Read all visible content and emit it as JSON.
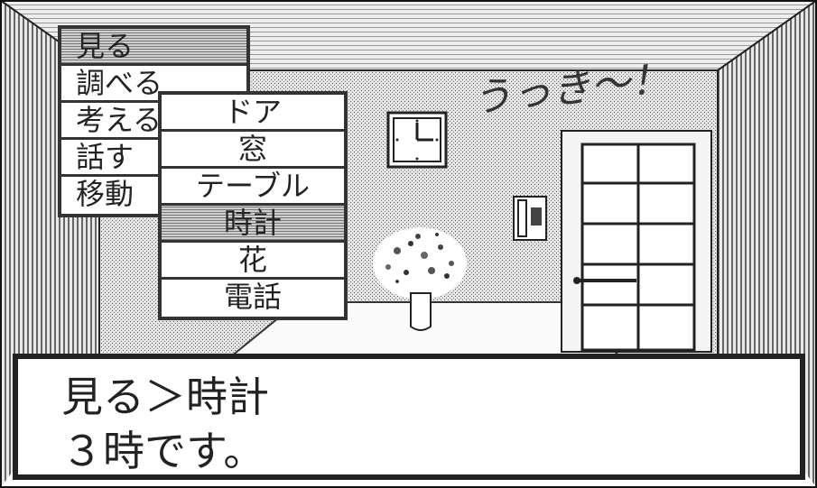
{
  "verb_menu": {
    "items": [
      "見る",
      "調べる",
      "考える",
      "話す",
      "移動"
    ],
    "selected": 0
  },
  "object_menu": {
    "items": [
      "ドア",
      "窓",
      "テーブル",
      "時計",
      "花",
      "電話"
    ],
    "selected": 3
  },
  "message": {
    "line1": "見る＞時計",
    "line2": "３時です。"
  },
  "speech": "うっき〜！",
  "icons": [
    "wall-clock-icon",
    "wall-telephone-icon",
    "flower-vase-icon",
    "door-icon"
  ]
}
